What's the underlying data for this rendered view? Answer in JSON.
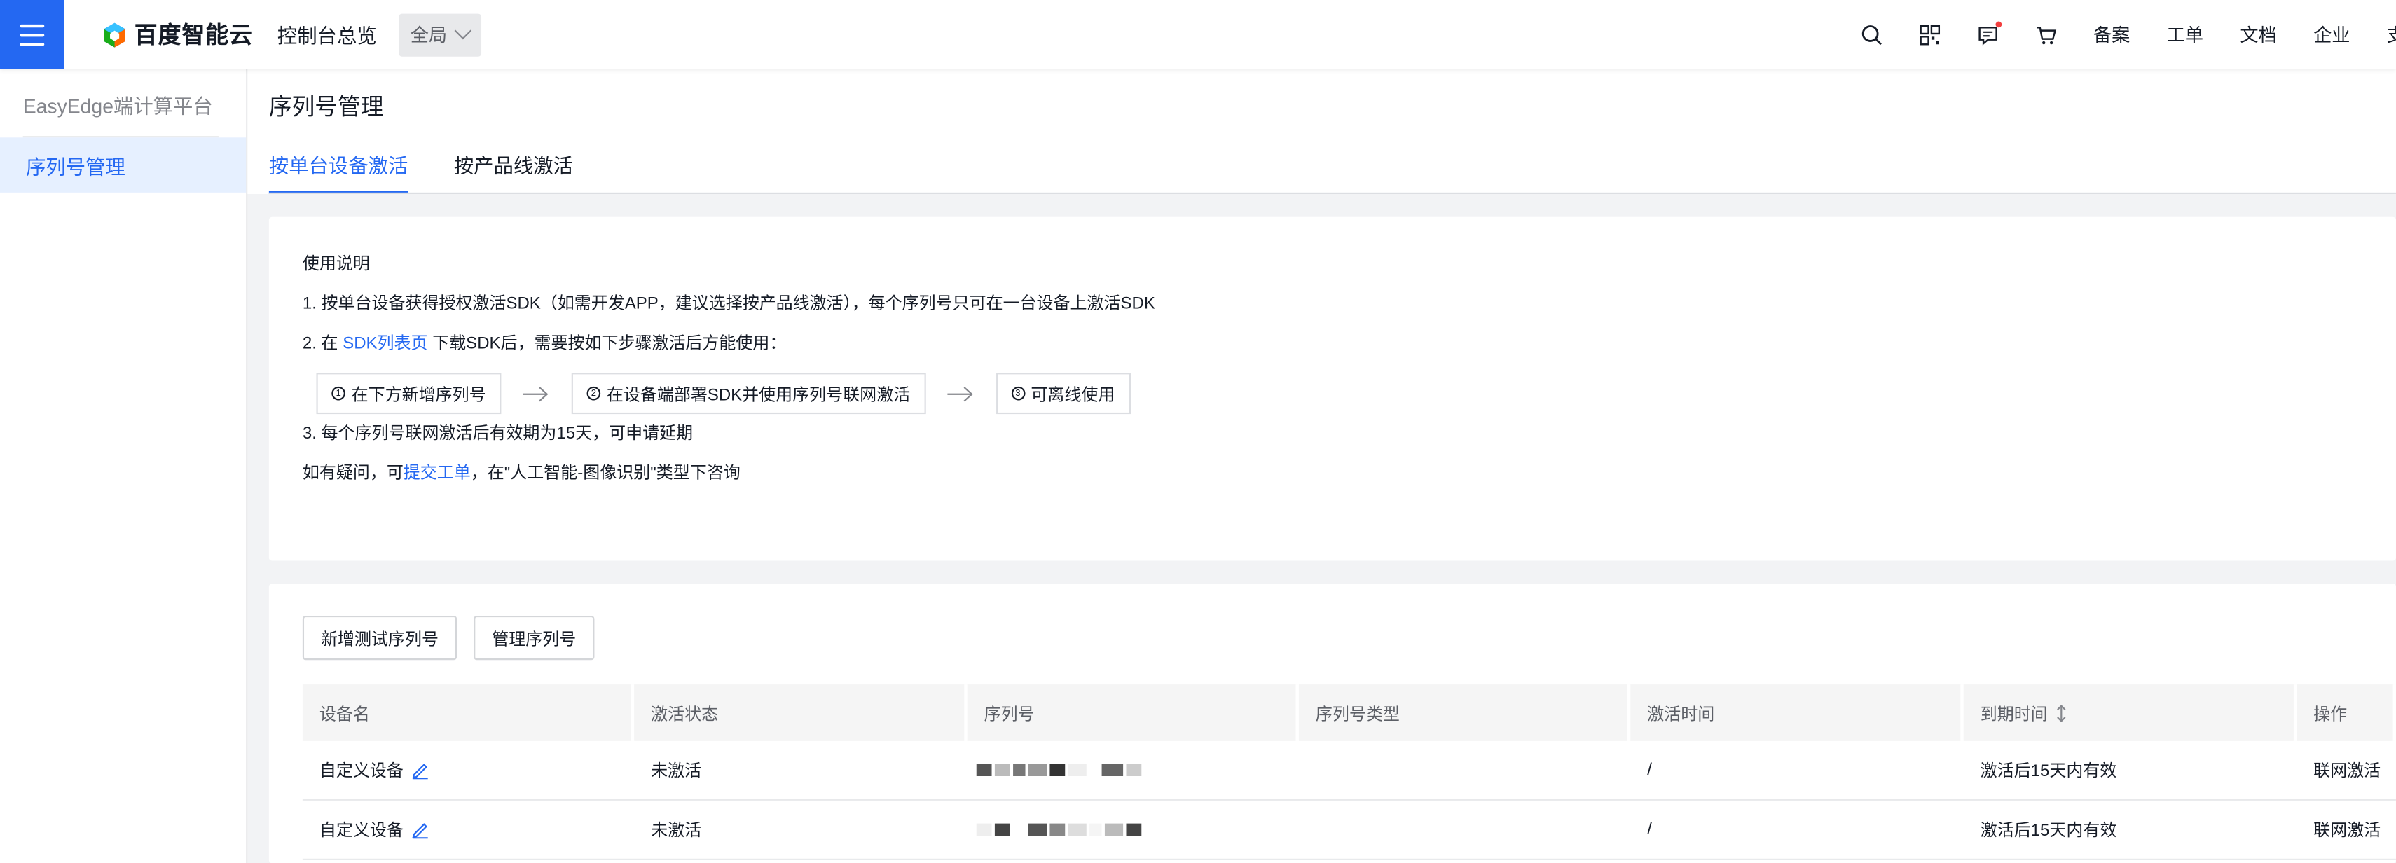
{
  "topbar": {
    "brand": "百度智能云",
    "console": "控制台总览",
    "region": "全局",
    "links": [
      "备案",
      "工单",
      "文档",
      "企业",
      "支"
    ]
  },
  "sidebar": {
    "title": "EasyEdge端计算平台",
    "items": [
      {
        "label": "序列号管理",
        "active": true
      }
    ]
  },
  "page": {
    "title": "序列号管理",
    "tabs": [
      {
        "label": "按单台设备激活",
        "active": true
      },
      {
        "label": "按产品线激活",
        "active": false
      }
    ]
  },
  "guide": {
    "heading": "使用说明",
    "line1": "1. 按单台设备获得授权激活SDK（如需开发APP，建议选择按产品线激活），每个序列号只可在一台设备上激活SDK",
    "line2_prefix": "2. 在 ",
    "line2_link": "SDK列表页",
    "line2_suffix": " 下载SDK后，需要按如下步骤激活后方能使用：",
    "steps": [
      {
        "num": "1",
        "label": "在下方新增序列号"
      },
      {
        "num": "2",
        "label": "在设备端部署SDK并使用序列号联网激活"
      },
      {
        "num": "3",
        "label": "可离线使用"
      }
    ],
    "line3": "3. 每个序列号联网激活后有效期为15天，可申请延期",
    "line4_prefix": "如有疑问，可",
    "line4_link": "提交工单",
    "line4_suffix": "，在\"人工智能-图像识别\"类型下咨询"
  },
  "actions": {
    "add_test": "新增测试序列号",
    "manage": "管理序列号"
  },
  "table": {
    "columns": [
      "设备名",
      "激活状态",
      "序列号",
      "序列号类型",
      "激活时间",
      "到期时间",
      "操作"
    ],
    "rows": [
      {
        "device": "自定义设备",
        "status": "未激活",
        "serial": "",
        "type": "",
        "activated": "/",
        "expiry": "激活后15天内有效",
        "action": "联网激活"
      },
      {
        "device": "自定义设备",
        "status": "未激活",
        "serial": "",
        "type": "",
        "activated": "/",
        "expiry": "激活后15天内有效",
        "action": "联网激活"
      }
    ]
  },
  "colors": {
    "primary": "#2468f2",
    "badge": "#f33e3e"
  }
}
